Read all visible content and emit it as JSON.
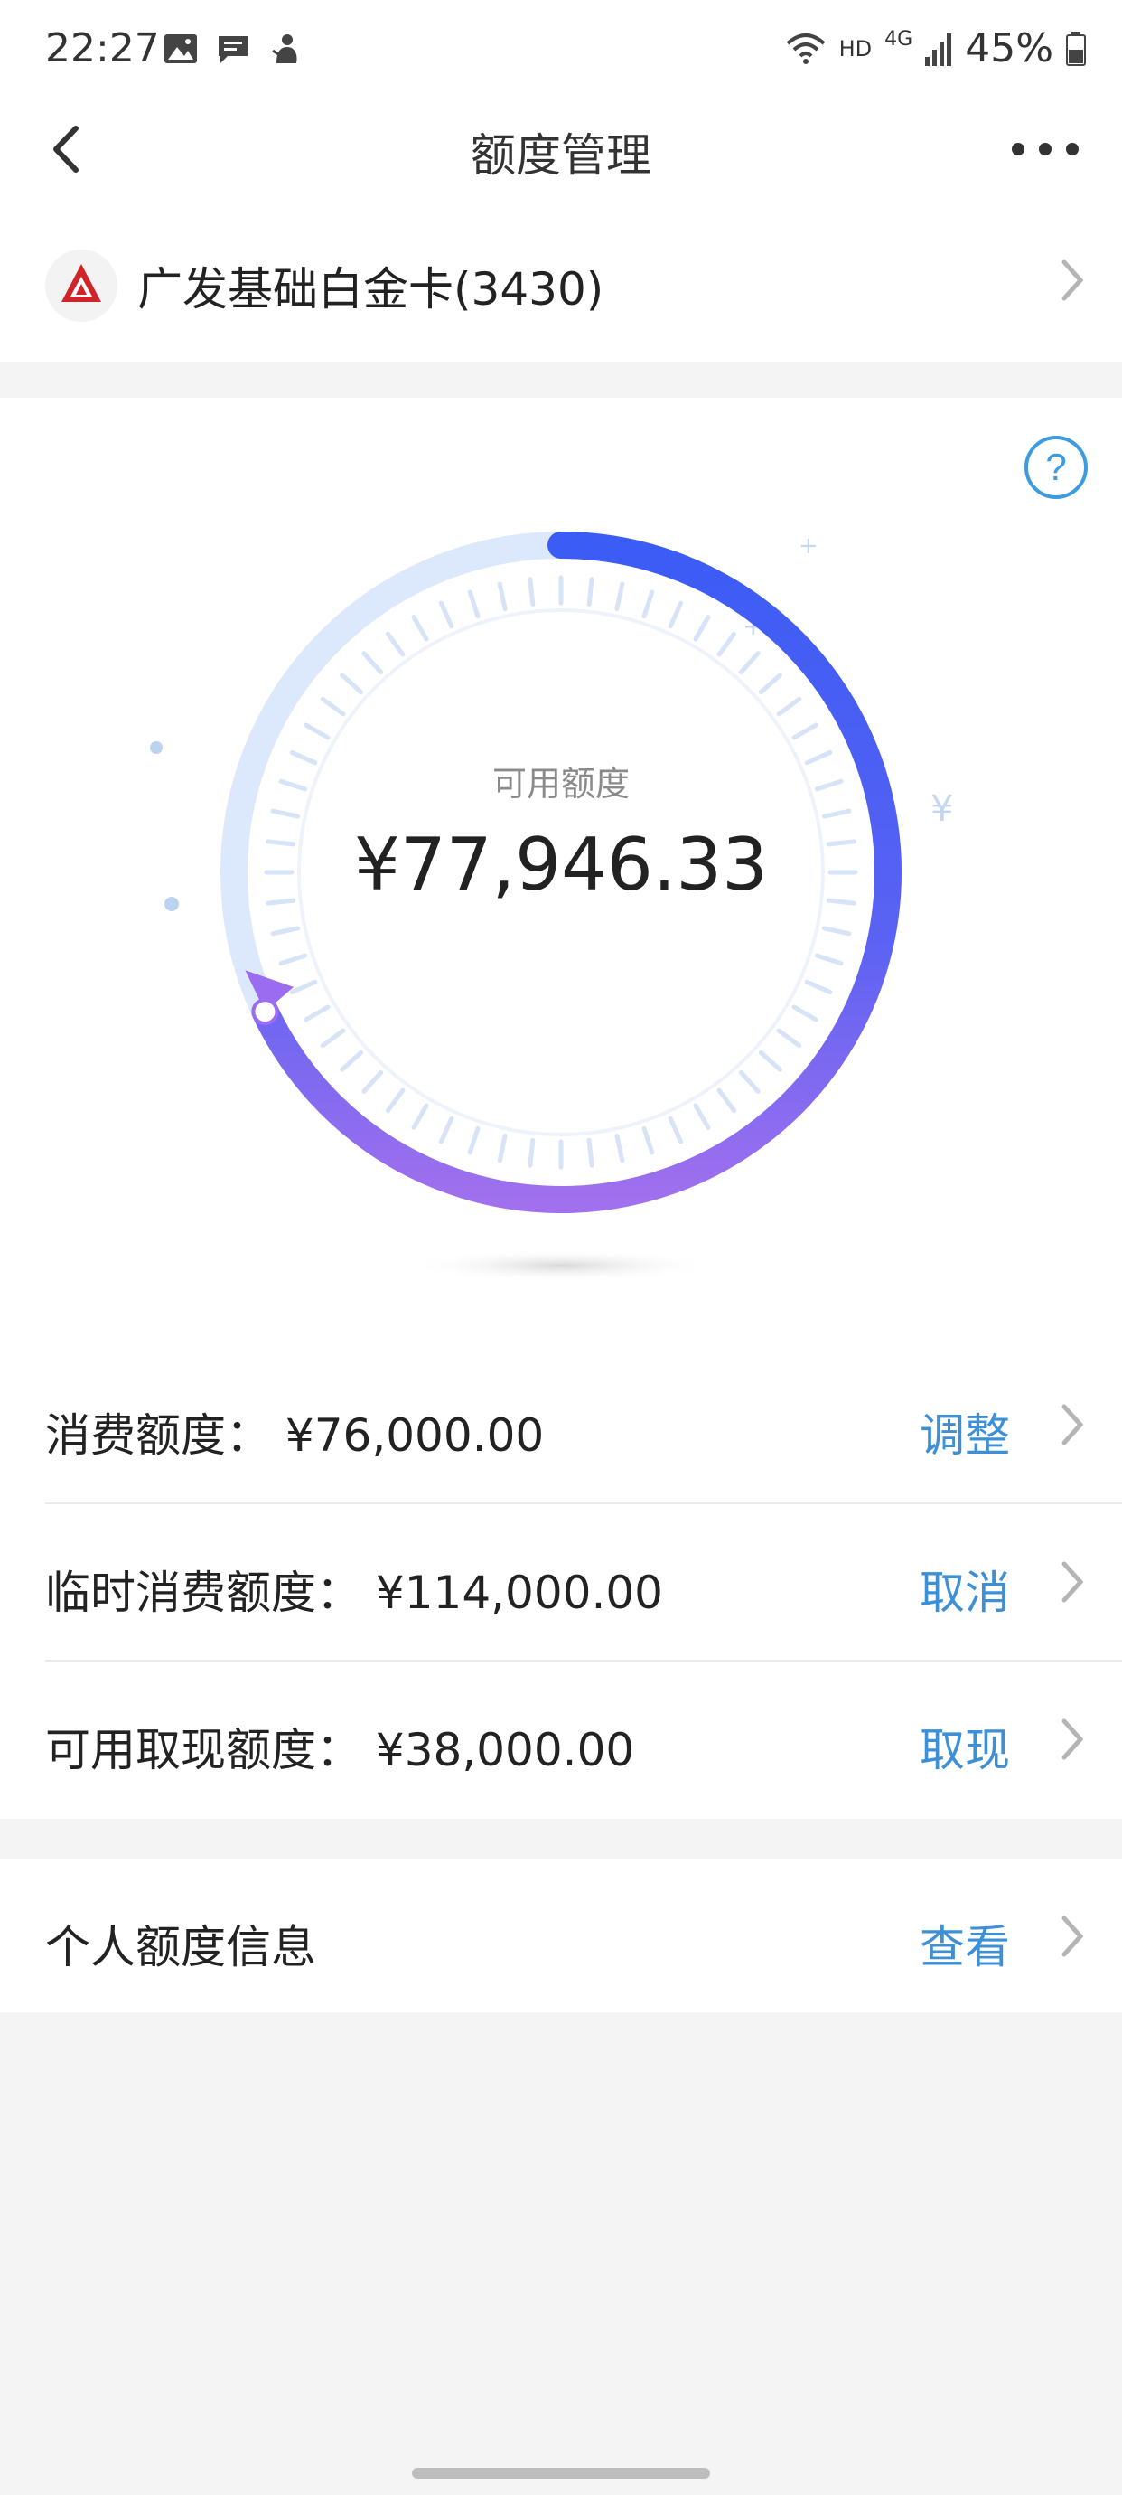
{
  "status_bar": {
    "time": "22:27",
    "left_icons": [
      "image-icon",
      "message-icon",
      "notification-icon"
    ],
    "network": "HD",
    "signal": "4G",
    "battery": "45%"
  },
  "nav": {
    "title": "额度管理",
    "back_icon": "back-arrow-icon",
    "more_icon": "more-icon"
  },
  "card": {
    "name": "广发基础白金卡(3430)",
    "logo_icon": "bank-logo-icon",
    "chevron_icon": "chevron-right-icon"
  },
  "gauge": {
    "label": "可用额度",
    "amount": "¥77,946.33",
    "help_icon": "question-icon",
    "progress_fraction": 0.68
  },
  "limits": [
    {
      "label": "消费额度：",
      "amount": "¥76,000.00",
      "action": "调整"
    },
    {
      "label": "临时消费额度：",
      "amount": "¥114,000.00",
      "action": "取消"
    },
    {
      "label": "可用取现额度：",
      "amount": "¥38,000.00",
      "action": "取现"
    }
  ],
  "personal": {
    "label": "个人额度信息",
    "action": "查看"
  },
  "colors": {
    "accent_blue": "#3d8fd6",
    "ring_start": "#9b6cf0",
    "ring_end": "#3b5cf5",
    "ring_track": "#dce8fb",
    "logo_red": "#d0242b"
  }
}
